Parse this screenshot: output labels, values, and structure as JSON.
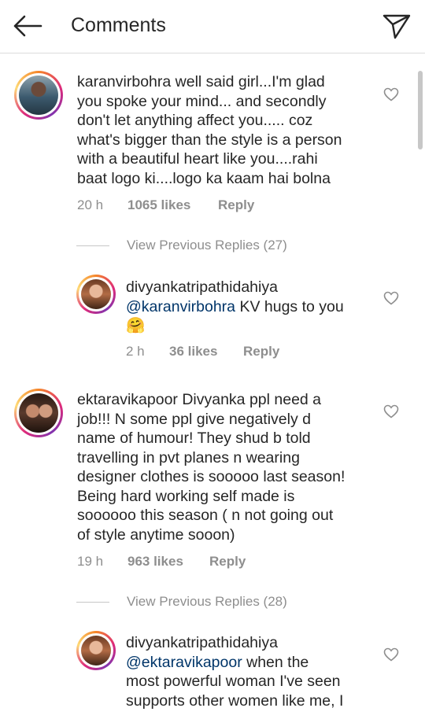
{
  "header": {
    "title": "Comments"
  },
  "comments": [
    {
      "username": "karanvirbohra",
      "lines": [
        "well said girl...I'm glad",
        "you spoke your mind... and secondly",
        "don't let anything affect you..... coz",
        "what's bigger than the style is a person",
        "with a beautiful heart like you....rahi",
        "baat logo ki....logo ka kaam hai bolna"
      ],
      "time": "20 h",
      "likes": "1065 likes",
      "reply": "Reply"
    },
    {
      "username": "ektaravikapoor",
      "lines": [
        "Divyanka ppl need a",
        "job!!! N some ppl give negatively d",
        "name of humour! They shud b told",
        "travelling in pvt planes n wearing",
        "designer clothes is sooooo last season!",
        "Being hard working self made is",
        "soooooo this season ( n not going out",
        "of style anytime sooon)"
      ],
      "time": "19 h",
      "likes": "963 likes",
      "reply": "Reply"
    }
  ],
  "replies": [
    {
      "view_previous": "View Previous Replies (27)",
      "username": "divyankatripathidahiya",
      "mention": "@karanvirbohra",
      "text": " KV hugs to you",
      "emoji": "🤗",
      "time": "2 h",
      "likes": "36 likes",
      "reply": "Reply"
    },
    {
      "view_previous": "View Previous Replies (28)",
      "username": "divyankatripathidahiya",
      "mention": "@ektaravikapoor",
      "text": " when the",
      "lines": [
        "most powerful woman I've seen",
        "supports other women like me, I"
      ]
    }
  ],
  "icons": {
    "back": "arrow-left-icon",
    "send": "paper-plane-icon",
    "like": "heart-outline-icon"
  }
}
